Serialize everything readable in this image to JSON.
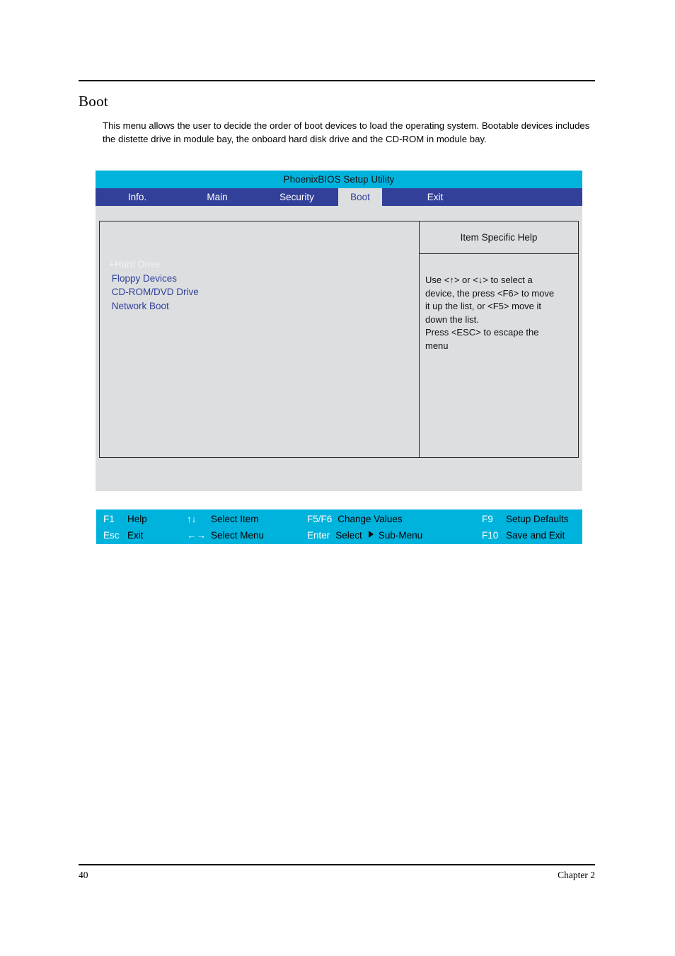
{
  "document": {
    "section_title": "Boot",
    "intro_paragraph": "This menu allows the user to decide the order of boot devices to load the operating system. Bootable devices includes the distette drive in module bay, the onboard hard disk drive and the CD-ROM in module bay.",
    "footer_page_number": "40",
    "footer_chapter": "Chapter 2"
  },
  "bios": {
    "title": "PhoenixBIOS Setup Utility",
    "colors": {
      "title_bar": "#00b3dd",
      "tab_bar": "#32409a",
      "body": "#dcdee0",
      "active_tab_text": "#32409a",
      "list_text": "#32409a",
      "selected_text": "#f2f2f4",
      "key_bar": "#00b3dd"
    },
    "tabs": [
      {
        "label": "Info.",
        "active": false
      },
      {
        "label": "Main",
        "active": false
      },
      {
        "label": "Security",
        "active": false
      },
      {
        "label": "Boot",
        "active": true
      },
      {
        "label": "Exit",
        "active": false
      }
    ],
    "boot_order": [
      {
        "label": "+Hard Drive",
        "selected": true
      },
      {
        "label": " Floppy Devices",
        "selected": false
      },
      {
        "label": " CD-ROM/DVD Drive",
        "selected": false
      },
      {
        "label": " Network Boot",
        "selected": false
      }
    ],
    "help": {
      "title": "Item Specific Help",
      "line1": "Use <↑> or <↓> to select a",
      "line2": "device, the press <F6> to move",
      "line3": "it up the list, or <F5> move it",
      "line4": "down the list.",
      "line5": "Press <ESC> to escape the",
      "line6": "menu"
    },
    "keybar": {
      "row1": [
        {
          "key": "F1",
          "desc": "Help"
        },
        {
          "key": "↑↓",
          "desc": "Select Item"
        },
        {
          "key": "F5/F6",
          "desc": "Change Values"
        },
        {
          "key": "F9",
          "desc": "Setup Defaults"
        }
      ],
      "row2": [
        {
          "key": "Esc",
          "desc": "Exit"
        },
        {
          "key": "←→",
          "desc": "Select Menu"
        },
        {
          "key": "Enter",
          "desc": "Select"
        },
        {
          "key": "F10",
          "desc": "Save and Exit"
        }
      ],
      "submenu_label": "Sub-Menu"
    }
  }
}
